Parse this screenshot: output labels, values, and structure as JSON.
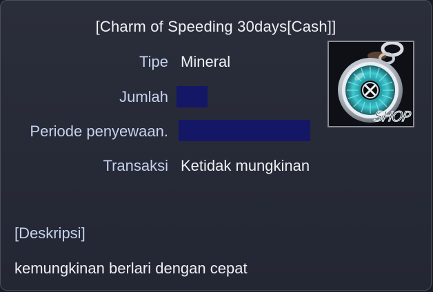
{
  "item": {
    "title": "[Charm of Speeding 30days[Cash]]",
    "icon": "speed-charm-eye-icon",
    "icon_badge": "SHOP"
  },
  "fields": {
    "type_label": "Tipe",
    "type_value": "Mineral",
    "quantity_label": "Jumlah",
    "rental_period_label": "Periode penyewaan.",
    "transaction_label": "Transaksi",
    "transaction_value": "Ketidak mungkinan"
  },
  "description": {
    "heading": "[Deskripsi]",
    "text": "kemungkinan berlari dengan cepat"
  },
  "colors": {
    "label": "#c6d2ef",
    "value": "#eef0f4",
    "panel": "#262936",
    "redaction": "#141666",
    "charm_iris": "#3fc8cf"
  }
}
